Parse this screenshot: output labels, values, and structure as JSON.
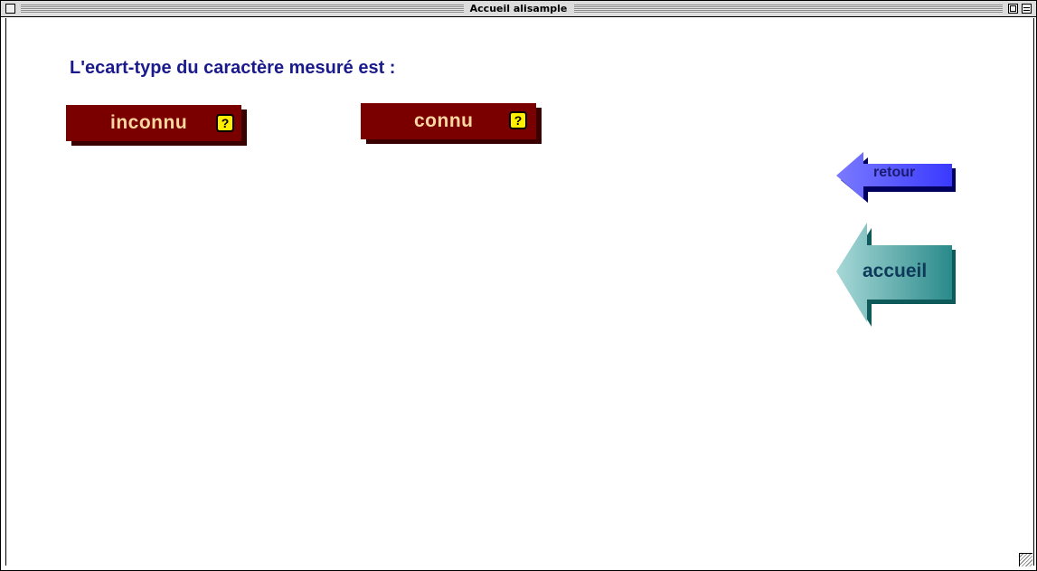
{
  "window": {
    "title": "Accueil alisample"
  },
  "main": {
    "question": "L'ecart-type du caractère mesuré est :",
    "choices": [
      {
        "label": "inconnu",
        "help": "?"
      },
      {
        "label": "connu",
        "help": "?"
      }
    ],
    "nav": {
      "retour_label": "retour",
      "accueil_label": "accueil"
    }
  },
  "colors": {
    "question_text": "#1a1a8c",
    "choice_button": "#7a0000",
    "choice_label": "#ffd7a0",
    "help_icon": "#ffee00",
    "retour_arrow": "#4a4aff",
    "accueil_arrow": "#2a8a8a"
  },
  "icons": {
    "help": "question-mark-icon",
    "retour": "left-arrow-icon",
    "accueil": "left-arrow-icon"
  }
}
